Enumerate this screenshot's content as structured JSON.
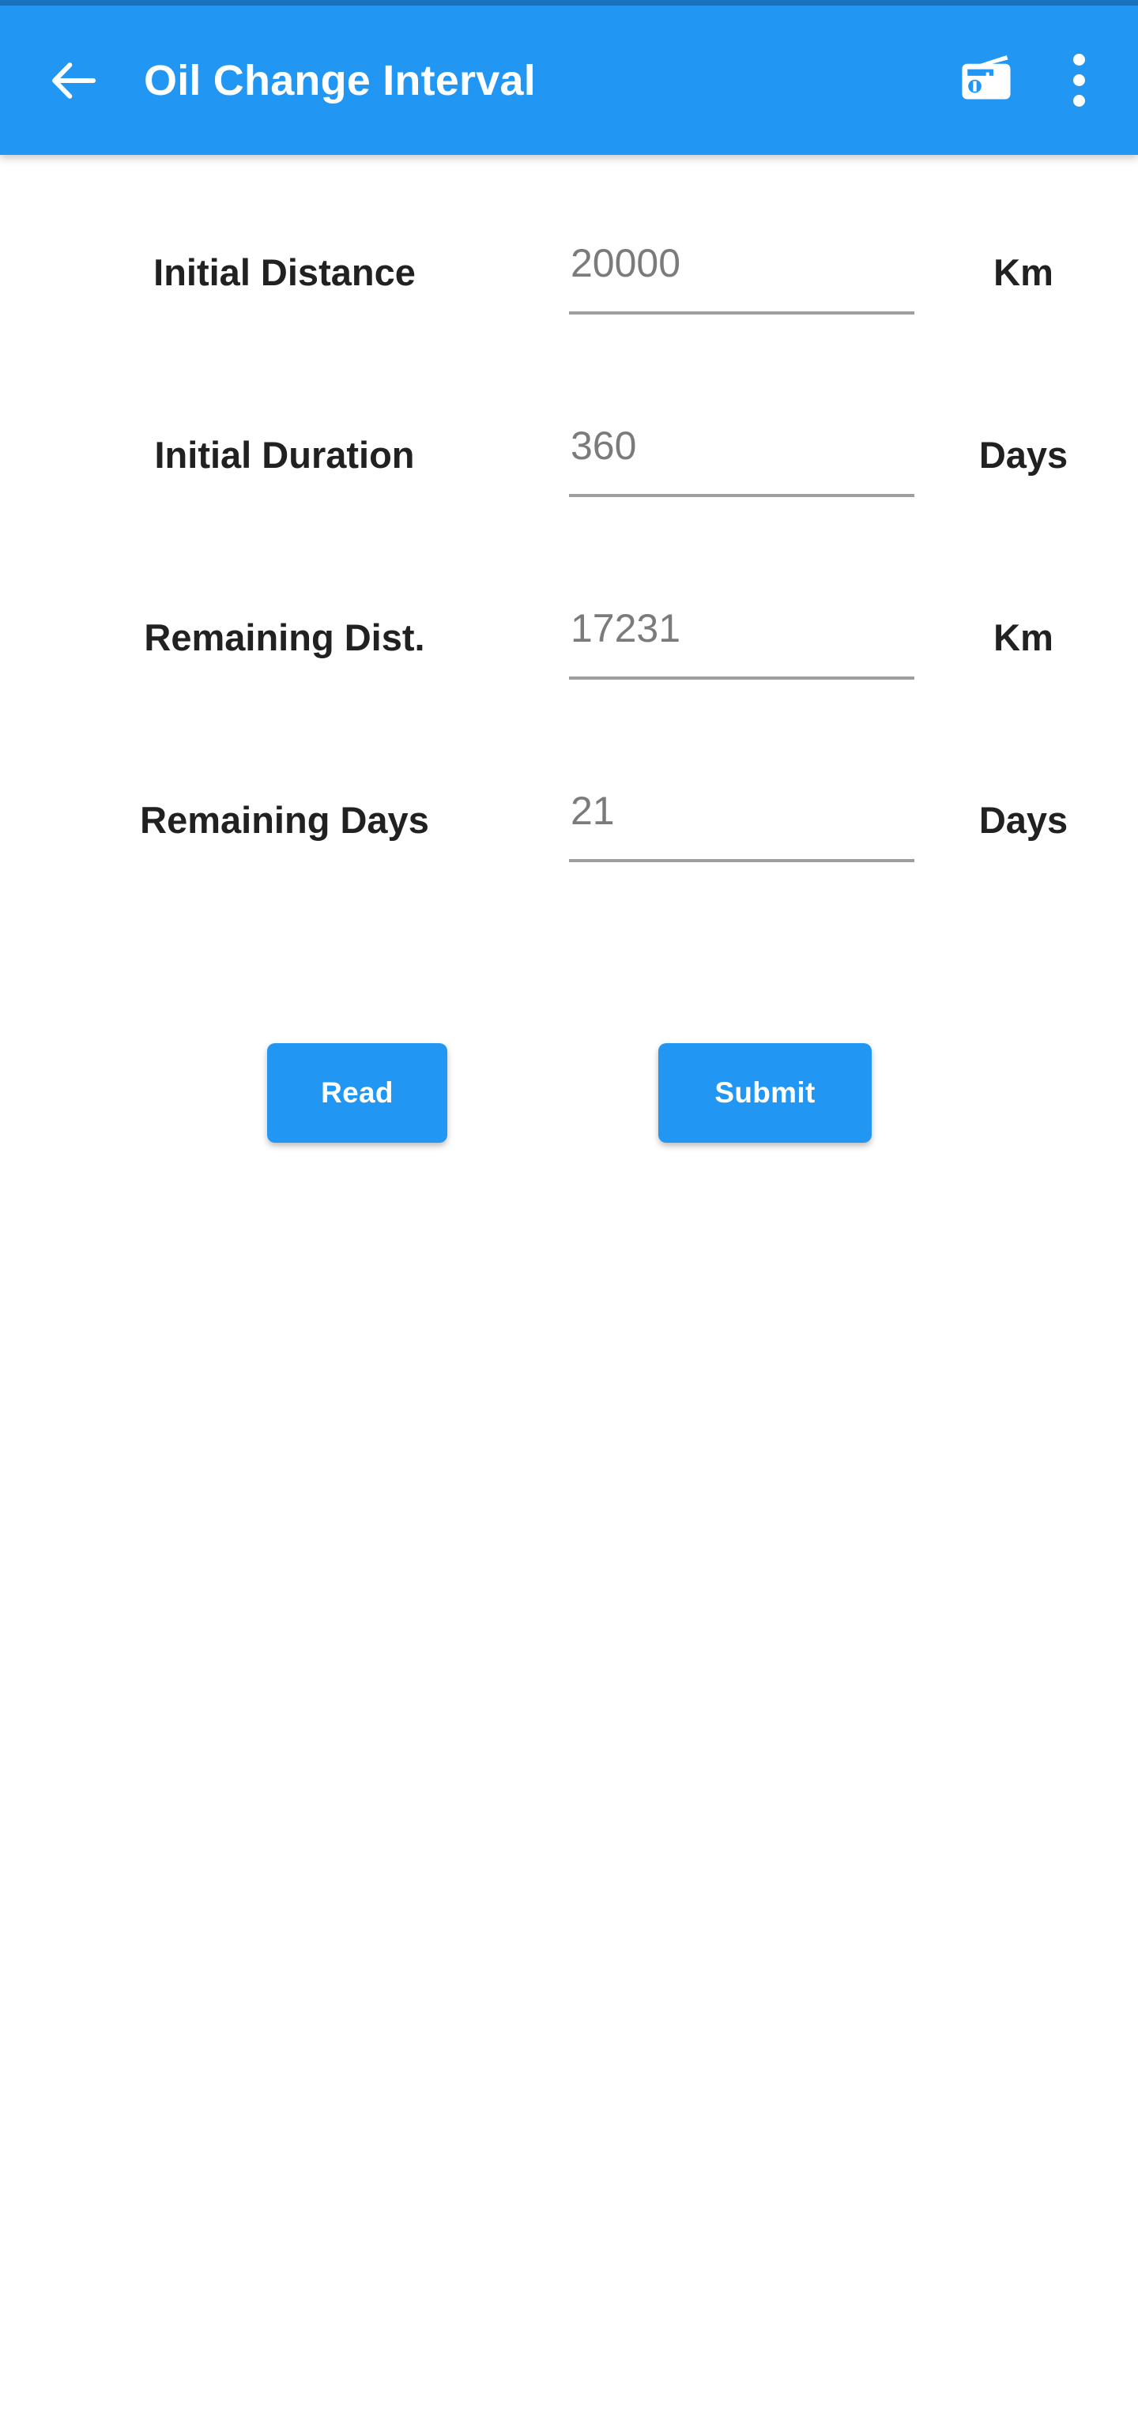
{
  "app_bar": {
    "title": "Oil Change Interval",
    "back_icon": "arrow-left-icon",
    "radio_icon": "radio-icon",
    "overflow_icon": "more-vertical-icon",
    "background_color": "#2196f3",
    "status_strip_color": "#1b74c4",
    "title_color": "#ffffff"
  },
  "form": {
    "rows": [
      {
        "label": "Initial Distance",
        "value": "20000",
        "unit": "Km"
      },
      {
        "label": "Initial Duration",
        "value": "360",
        "unit": "Days"
      },
      {
        "label": "Remaining Dist.",
        "value": "17231",
        "unit": "Km"
      },
      {
        "label": "Remaining Days",
        "value": "21",
        "unit": "Days"
      }
    ],
    "value_color": "#7b7b7b",
    "label_color": "#212121",
    "underline_color": "#9e9e9e"
  },
  "buttons": {
    "read_label": "Read",
    "submit_label": "Submit",
    "color": "#2196f3",
    "text_color": "#ffffff"
  }
}
